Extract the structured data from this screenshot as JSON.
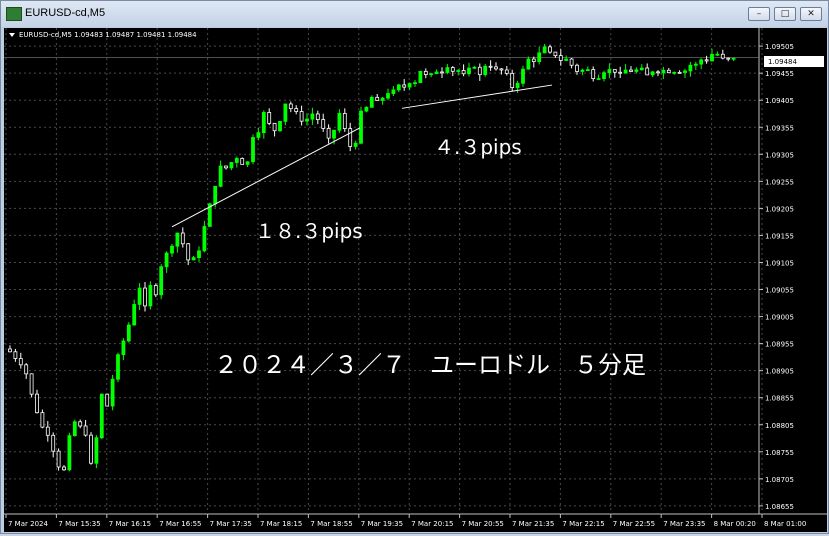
{
  "window": {
    "title": "EURUSD-cd,M5",
    "min_symbol": "–",
    "max_symbol": "□",
    "close_symbol": "✕"
  },
  "chart_info": "EURUSD-cd,M5  1.09483 1.09487 1.09481 1.09484",
  "current_price": "1.09484",
  "annotations": {
    "left_move": "１８.３pips",
    "right_move": "４.３pips",
    "caption": "２０２４／３／７　ユーロドル　５分足"
  },
  "colors": {
    "background": "#000000",
    "grid": "#4a4a4a",
    "bull": "#00ff00",
    "bear": "#ffffff",
    "text": "#ffffff"
  },
  "chart_data": {
    "type": "candlestick",
    "symbol": "EURUSD-cd",
    "timeframe": "M5",
    "ylim": [
      1.0864,
      1.0952
    ],
    "y_ticks": [
      "1.09505",
      "1.09455",
      "1.09405",
      "1.09355",
      "1.09305",
      "1.09255",
      "1.09205",
      "1.09155",
      "1.09105",
      "1.09055",
      "1.09005",
      "1.08955",
      "1.08905",
      "1.08855",
      "1.08805",
      "1.08755",
      "1.08705",
      "1.08655"
    ],
    "x_ticks": [
      "7 Mar 2024",
      "7 Mar 15:35",
      "7 Mar 16:15",
      "7 Mar 16:55",
      "7 Mar 17:35",
      "7 Mar 18:15",
      "7 Mar 18:55",
      "7 Mar 19:35",
      "7 Mar 20:15",
      "7 Mar 20:55",
      "7 Mar 21:35",
      "7 Mar 22:15",
      "7 Mar 22:55",
      "7 Mar 23:35",
      "8 Mar 00:20",
      "8 Mar 01:00"
    ],
    "close_path": [
      1.0894,
      1.0893,
      1.0892,
      1.089,
      1.0886,
      1.0883,
      1.088,
      1.0879,
      1.0876,
      1.0873,
      1.0872,
      1.0878,
      1.0881,
      1.088,
      1.0879,
      1.0873,
      1.0878,
      1.0886,
      1.0884,
      1.0889,
      1.0893,
      1.0896,
      1.0899,
      1.0903,
      1.0906,
      1.0902,
      1.0906,
      1.0905,
      1.091,
      1.0912,
      1.0914,
      1.0916,
      1.0914,
      1.0911,
      1.0911,
      1.0913,
      1.0917,
      1.0921,
      1.0925,
      1.0928,
      1.0928,
      1.0929,
      1.093,
      1.0929,
      1.0929,
      1.0934,
      1.0935,
      1.0938,
      1.0936,
      1.0935,
      1.0937,
      1.094,
      1.0939,
      1.0938,
      1.0937,
      1.0937,
      1.0938,
      1.0937,
      1.0935,
      1.0933,
      1.0935,
      1.0938,
      1.0935,
      1.0932,
      1.0933,
      1.0938,
      1.0939,
      1.0941,
      1.094,
      1.0941,
      1.0942,
      1.0942,
      1.0943,
      1.0943,
      1.0944,
      1.0944,
      1.0946,
      1.0945,
      1.0945,
      1.0946,
      1.0946,
      1.0947,
      1.0946,
      1.0946,
      1.0945,
      1.0946,
      1.0947,
      1.0945,
      1.0947,
      1.0947,
      1.0946,
      1.0946,
      1.0945,
      1.0943,
      1.0944,
      1.0946,
      1.0948,
      1.0948,
      1.0949,
      1.095,
      1.0949,
      1.0949,
      1.0948,
      1.0948,
      1.0947,
      1.0946,
      1.0946,
      1.0946,
      1.0945,
      1.0945,
      1.0946,
      1.0946,
      1.0946,
      1.0945,
      1.0946,
      1.0946,
      1.0946,
      1.0946,
      1.0945,
      1.0946,
      1.0946,
      1.0946,
      1.0946,
      1.0946,
      1.0946,
      1.0946,
      1.0947,
      1.0947,
      1.0948,
      1.0948,
      1.0949,
      1.0949,
      1.0948,
      1.0948,
      1.0948
    ],
    "trendlines": [
      {
        "label": "１８.３pips",
        "from_price": 1.09171,
        "to_price": 1.09354
      },
      {
        "label": "４.３pips",
        "from_price": 1.0939,
        "to_price": 1.09433
      }
    ]
  }
}
